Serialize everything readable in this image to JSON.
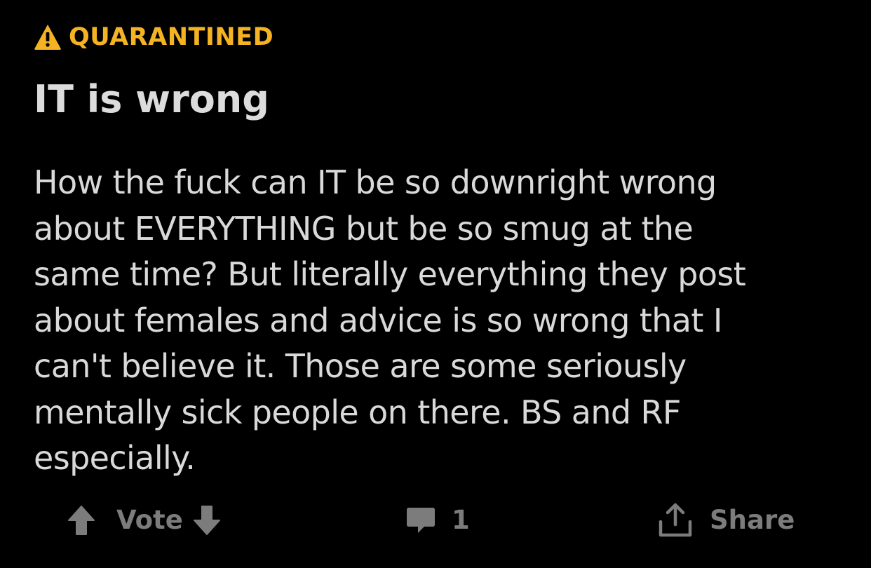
{
  "post": {
    "quarantine_label": "QUARANTINED",
    "title": "IT is wrong",
    "body_lines": [
      "How the fuck can IT be so downright wrong",
      "about EVERYTHING but be so smug at the",
      "same time? But literally everything they post",
      "about females and advice is so wrong that I",
      "can't believe it. Those are some seriously",
      "mentally sick people on there. BS and RF",
      "especially."
    ]
  },
  "actions": {
    "vote_label": "Vote",
    "comment_count": "1",
    "share_label": "Share"
  },
  "icons": {
    "warning": "warning-triangle-icon",
    "upvote": "arrow-up-icon",
    "downvote": "arrow-down-icon",
    "comment": "comment-bubble-icon",
    "share": "share-upload-icon"
  },
  "colors": {
    "background": "#000000",
    "quarantine": "#f5b324",
    "title": "#dcdcdc",
    "body": "#d9d9d9",
    "action": "#7c7c7c"
  }
}
